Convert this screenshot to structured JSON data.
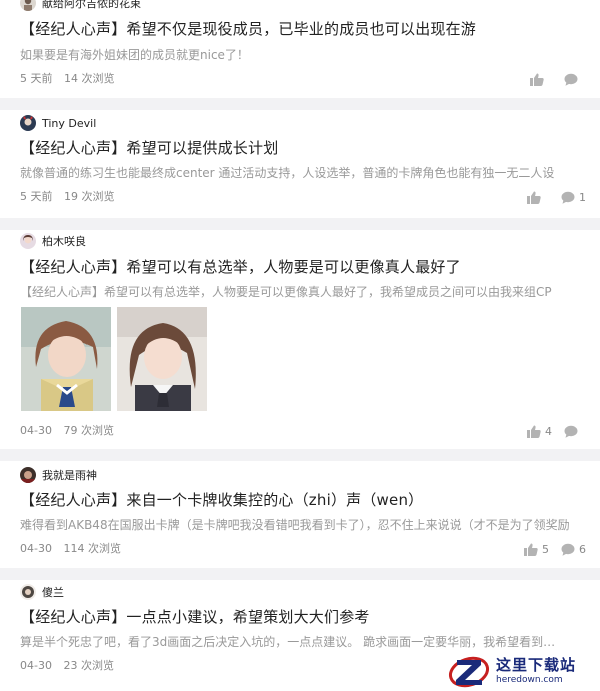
{
  "posts": [
    {
      "author": "献给阿尔吉侬的花束",
      "title": "【经纪人心声】希望不仅是现役成员，已毕业的成员也可以出现在游",
      "excerpt": "如果要是有海外姐妹团的成员就更nice了！",
      "date": "5 天前",
      "views": "14 次浏览",
      "likes": "",
      "comments": ""
    },
    {
      "author": "Tiny Devil",
      "title": "【经纪人心声】希望可以提供成长计划",
      "excerpt": "就像普通的练习生也能最终成center 通过活动支持，人设选举，普通的卡牌角色也能有独一无二人设",
      "date": "5 天前",
      "views": "19 次浏览",
      "likes": "",
      "comments": "1"
    },
    {
      "author": "柏木咲良",
      "title": "【经纪人心声】希望可以有总选举，人物要是可以更像真人最好了",
      "excerpt": "【经纪人心声】希望可以有总选举，人物要是可以更像真人最好了，我希望成员之间可以由我来组CP",
      "date": "04-30",
      "views": "79 次浏览",
      "likes": "4",
      "comments": ""
    },
    {
      "author": "我就是雨神",
      "title": "【经纪人心声】来自一个卡牌收集控的心（zhi）声（wen）",
      "excerpt": "难得看到AKB48在国服出卡牌（是卡牌吧我没看错吧我看到卡了），忍不住上来说说（才不是为了领奖励",
      "date": "04-30",
      "views": "114 次浏览",
      "likes": "5",
      "comments": "6"
    },
    {
      "author": "傻兰",
      "title": "【经纪人心声】一点点小建议，希望策划大大们参考",
      "excerpt": "算是半个死忠了吧，看了3d画面之后决定入坑的，一点点建议。 跪求画面一定要华丽，我希望看到华丽的",
      "date": "04-30",
      "views": "23 次浏览",
      "likes": "",
      "comments": ""
    }
  ],
  "watermark": {
    "cn": "这里下载站",
    "url": "heredown.com"
  }
}
